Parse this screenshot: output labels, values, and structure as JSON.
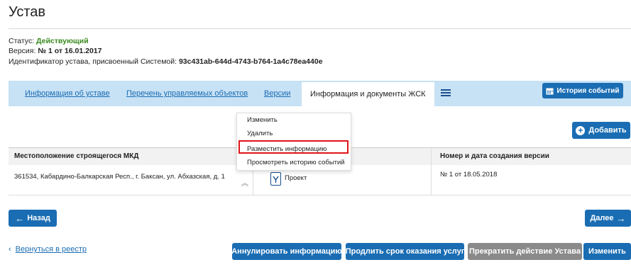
{
  "page": {
    "title": "Устав"
  },
  "meta": {
    "status_label": "Статус:",
    "status_value": "Действующий",
    "version_label": "Версия:",
    "version_value": "№ 1 от 16.01.2017",
    "id_label": "Идентификатор устава, присвоенный Системой:",
    "id_value": "93c431ab-644d-4743-b764-1a4c78ea440e"
  },
  "tabs": [
    {
      "label": "Информация об уставе"
    },
    {
      "label": "Перечень управляемых объектов"
    },
    {
      "label": "Версии"
    },
    {
      "label": "Информация и документы ЖСК"
    }
  ],
  "toolbar": {
    "history_label": "История событий",
    "add_label": "Добавить"
  },
  "table": {
    "headers": [
      "Местоположение строящегося МКД",
      "",
      "Номер и дата создания версии"
    ],
    "rows": [
      {
        "location": "361534, Кабардино-Балкарская Респ., г. Баксан, ул. Абхазская, д. 1",
        "state": "Проект",
        "version": "№ 1 от 18.05.2018"
      }
    ]
  },
  "dropdown": {
    "items": [
      "Изменить",
      "Удалить",
      "Разместить информацию",
      "Просмотреть историю событий"
    ]
  },
  "nav": {
    "back_label": "Назад",
    "next_label": "Далее",
    "registry_link": "Вернуться в реестр"
  },
  "actions": {
    "annul": "Аннулировать информацию",
    "prolong": "Продлить срок оказания услуг",
    "stop": "Прекратить действие Устава",
    "edit": "Изменить"
  },
  "colors": {
    "accent": "#1a6db3",
    "tabbar": "#c7e1f5",
    "status_green": "#3a8a1e",
    "highlight_red": "#e0151b",
    "disabled_gray": "#8a8a8a"
  }
}
